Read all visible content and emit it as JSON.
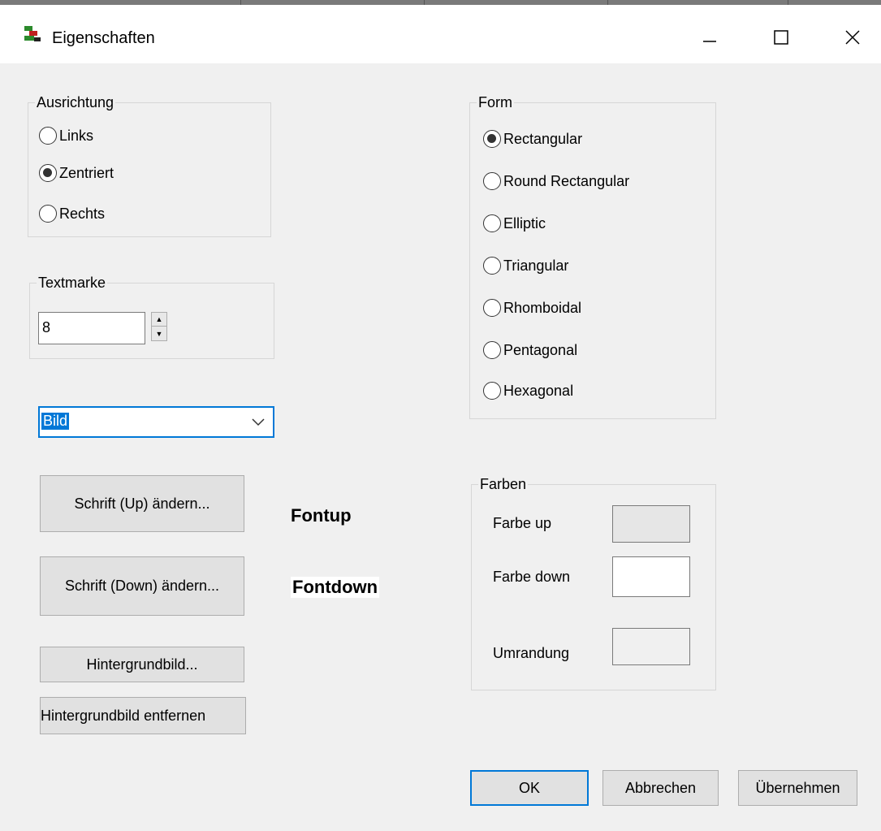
{
  "window": {
    "title": "Eigenschaften",
    "app_icon": "app-icon",
    "controls": {
      "minimize": "—",
      "maximize": "☐",
      "close": "✕"
    }
  },
  "ausrichtung": {
    "legend": "Ausrichtung",
    "options": [
      {
        "label": "Links",
        "checked": false
      },
      {
        "label": "Zentriert",
        "checked": true
      },
      {
        "label": "Rechts",
        "checked": false
      }
    ]
  },
  "textmarke": {
    "legend": "Textmarke",
    "value": "8",
    "up": "▲",
    "down": "▼"
  },
  "combo": {
    "selected": "Bild",
    "chevron": "⌵"
  },
  "form": {
    "legend": "Form",
    "options": [
      {
        "label": "Rectangular",
        "checked": true
      },
      {
        "label": "Round Rectangular",
        "checked": false
      },
      {
        "label": "Elliptic",
        "checked": false
      },
      {
        "label": "Triangular",
        "checked": false
      },
      {
        "label": "Rhomboidal",
        "checked": false
      },
      {
        "label": "Pentagonal",
        "checked": false
      },
      {
        "label": "Hexagonal",
        "checked": false
      }
    ]
  },
  "fonts": {
    "up_button": "Schrift (Up) ändern...",
    "up_preview": "Fontup",
    "down_button": "Schrift (Down) ändern...",
    "down_preview": "Fontdown"
  },
  "background": {
    "set_button": "Hintergrundbild...",
    "remove_button": "Hintergrundbild entfernen"
  },
  "farben": {
    "legend": "Farben",
    "up_label": "Farbe up",
    "up_color": "#e6e6e6",
    "down_label": "Farbe down",
    "down_color": "#ffffff",
    "border_label": "Umrandung",
    "border_color": "#f0f0f0"
  },
  "footer": {
    "ok": "OK",
    "cancel": "Abbrechen",
    "apply": "Übernehmen"
  },
  "colors": {
    "accent": "#0078d7",
    "client_bg": "#f0f0f0",
    "button_bg": "#e1e1e1"
  }
}
